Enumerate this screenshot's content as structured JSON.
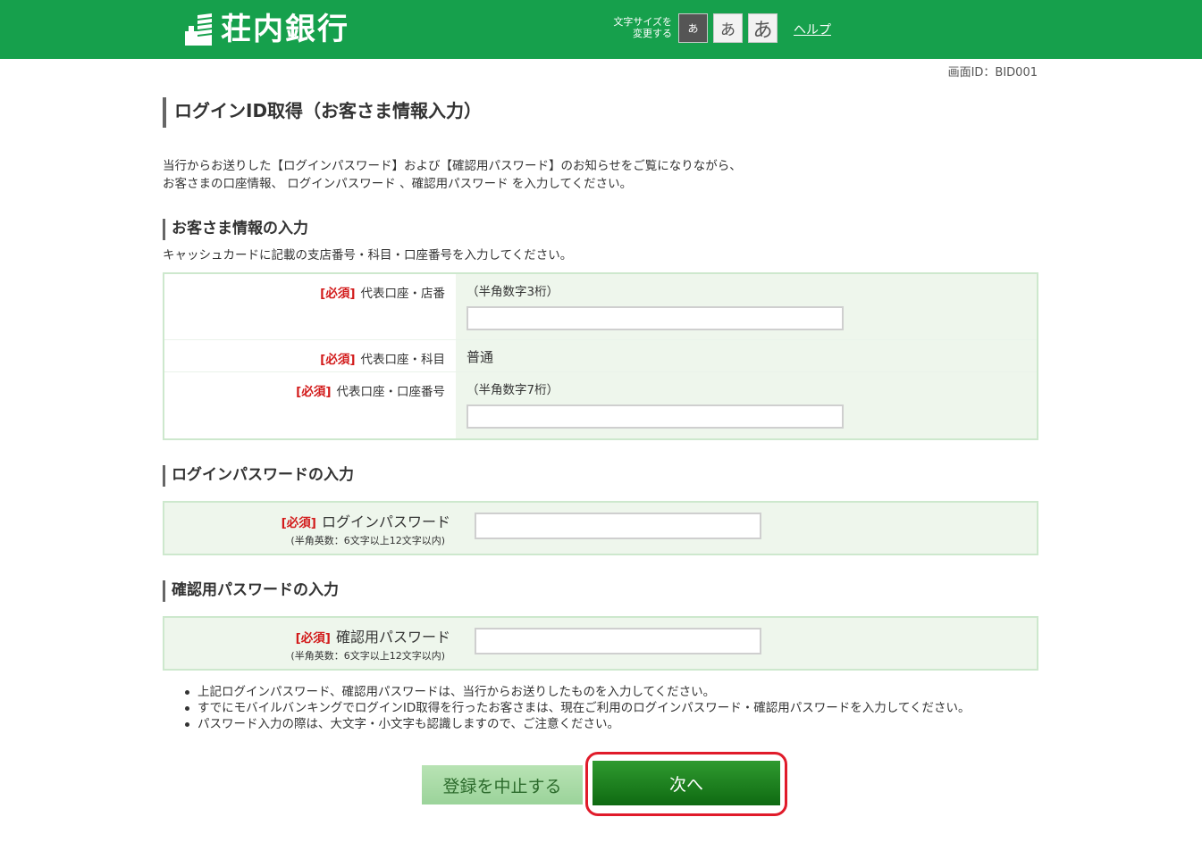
{
  "header": {
    "bank_name": "荘内銀行",
    "font_size_label_line1": "文字サイズを",
    "font_size_label_line2": "変更する",
    "font_small": "あ",
    "font_medium": "あ",
    "font_large": "あ",
    "help": "ヘルプ",
    "brand_color": "#16a04c"
  },
  "screen_id": "画面ID：BID001",
  "page_title": "ログインID取得（お客さま情報入力）",
  "intro": {
    "line1": "当行からお送りした【ログインパスワード】および【確認用パスワード】のお知らせをご覧になりながら、",
    "line2": "お客さまの口座情報、 ログインパスワード 、確認用パスワード を入力してください。"
  },
  "customer_section": {
    "title": "お客さま情報の入力",
    "subtitle": "キャッシュカードに記載の支店番号・科目・口座番号を入力してください。",
    "required_tag": "[必須]",
    "branch": {
      "label": "代表口座・店番",
      "hint": "（半角数字3桁）",
      "value": ""
    },
    "subject": {
      "label": "代表口座・科目",
      "value": "普通"
    },
    "account": {
      "label": "代表口座・口座番号",
      "hint": "（半角数字7桁）",
      "value": ""
    }
  },
  "login_pw_section": {
    "title": "ログインパスワードの入力",
    "required_tag": "[必須]",
    "label": "ログインパスワード",
    "note": "(半角英数：6文字以上12文字以内)",
    "value": ""
  },
  "confirm_pw_section": {
    "title": "確認用パスワードの入力",
    "required_tag": "[必須]",
    "label": "確認用パスワード",
    "note": "(半角英数：6文字以上12文字以内)",
    "value": ""
  },
  "notes": [
    "上記ログインパスワード、確認用パスワードは、当行からお送りしたものを入力してください。",
    "すでにモバイルバンキングでログインID取得を行ったお客さまは、現在ご利用のログインパスワード・確認用パスワードを入力してください。",
    "パスワード入力の際は、大文字・小文字も認識しますので、ご注意ください。"
  ],
  "buttons": {
    "cancel": "登録を中止する",
    "next": "次へ"
  },
  "colors": {
    "required": "#d21a1a",
    "highlight": "#e01b2a"
  }
}
